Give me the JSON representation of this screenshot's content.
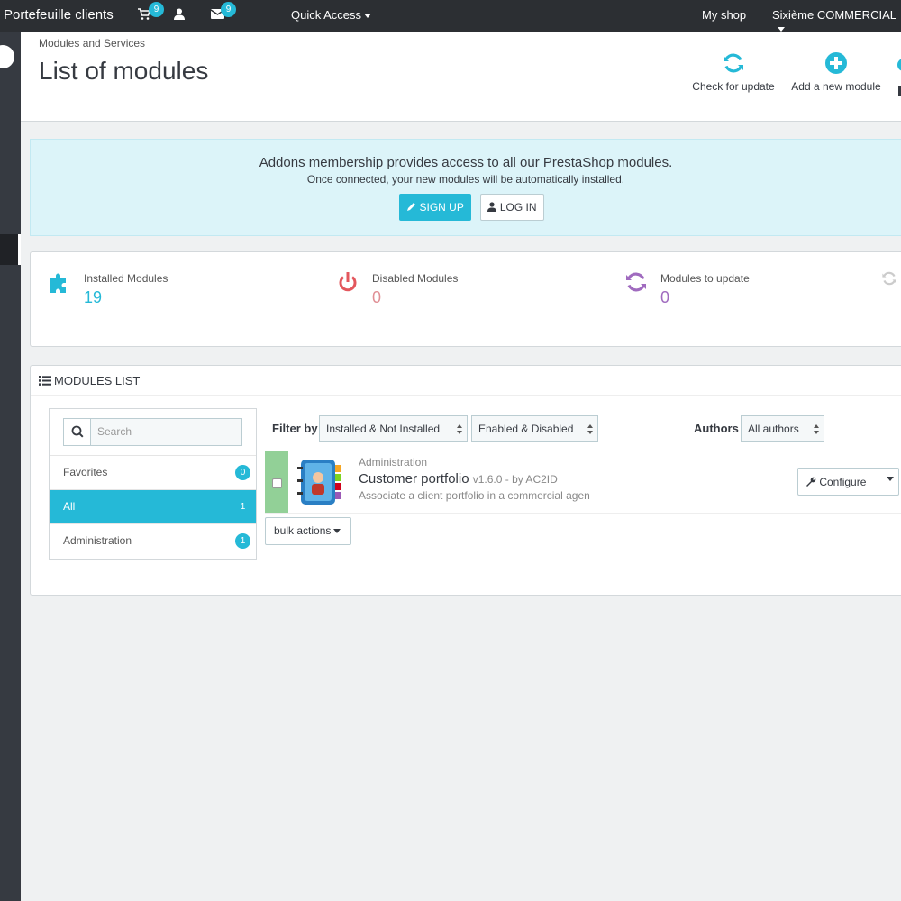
{
  "topbar": {
    "shop_name": "Portefeuille clients",
    "cart_badge": "9",
    "messages_badge": "9",
    "quick_access": "Quick Access",
    "my_shop": "My shop",
    "user_name": "Sixième COMMERCIAL"
  },
  "header": {
    "breadcrumb": "Modules and Services",
    "title": "List of modules",
    "toolbar": [
      {
        "label": "Check for update",
        "icon": "refresh-icon"
      },
      {
        "label": "Add a new module",
        "icon": "plus-circle-icon"
      }
    ]
  },
  "addons": {
    "title": "Addons membership provides access to all our PrestaShop modules.",
    "subtitle": "Once connected, your new modules will be automatically installed.",
    "signup_label": "SIGN UP",
    "login_label": "LOG IN"
  },
  "kpis": [
    {
      "label": "Installed Modules",
      "value": "19",
      "color": "#25b9d7",
      "icon": "puzzle-icon"
    },
    {
      "label": "Disabled Modules",
      "value": "0",
      "color": "#e08f95",
      "icon": "power-icon"
    },
    {
      "label": "Modules to update",
      "value": "0",
      "color": "#a06bbf",
      "icon": "refresh-icon"
    }
  ],
  "modules_list": {
    "heading": "Modules list",
    "search_placeholder": "Search",
    "categories": [
      {
        "label": "Favorites",
        "count": "0"
      },
      {
        "label": "All",
        "count": "1",
        "active": true
      },
      {
        "label": "Administration",
        "count": "1"
      }
    ],
    "filter_by_label": "Filter by",
    "install_filter": "Installed & Not Installed",
    "status_filter": "Enabled & Disabled",
    "authors_label": "Authors",
    "authors_filter": "All authors",
    "modules": [
      {
        "category": "Administration",
        "name": "Customer portfolio",
        "version_author": "v1.6.0 - by AC2ID",
        "description": "Associate a client portfolio in a commercial agen",
        "configure_label": "Configure"
      }
    ],
    "bulk_actions_label": "bulk actions"
  },
  "colors": {
    "accent": "#25b9d7",
    "topbar": "#2c2f33",
    "sidebar": "#363a41",
    "enabled_status": "#92d097"
  }
}
